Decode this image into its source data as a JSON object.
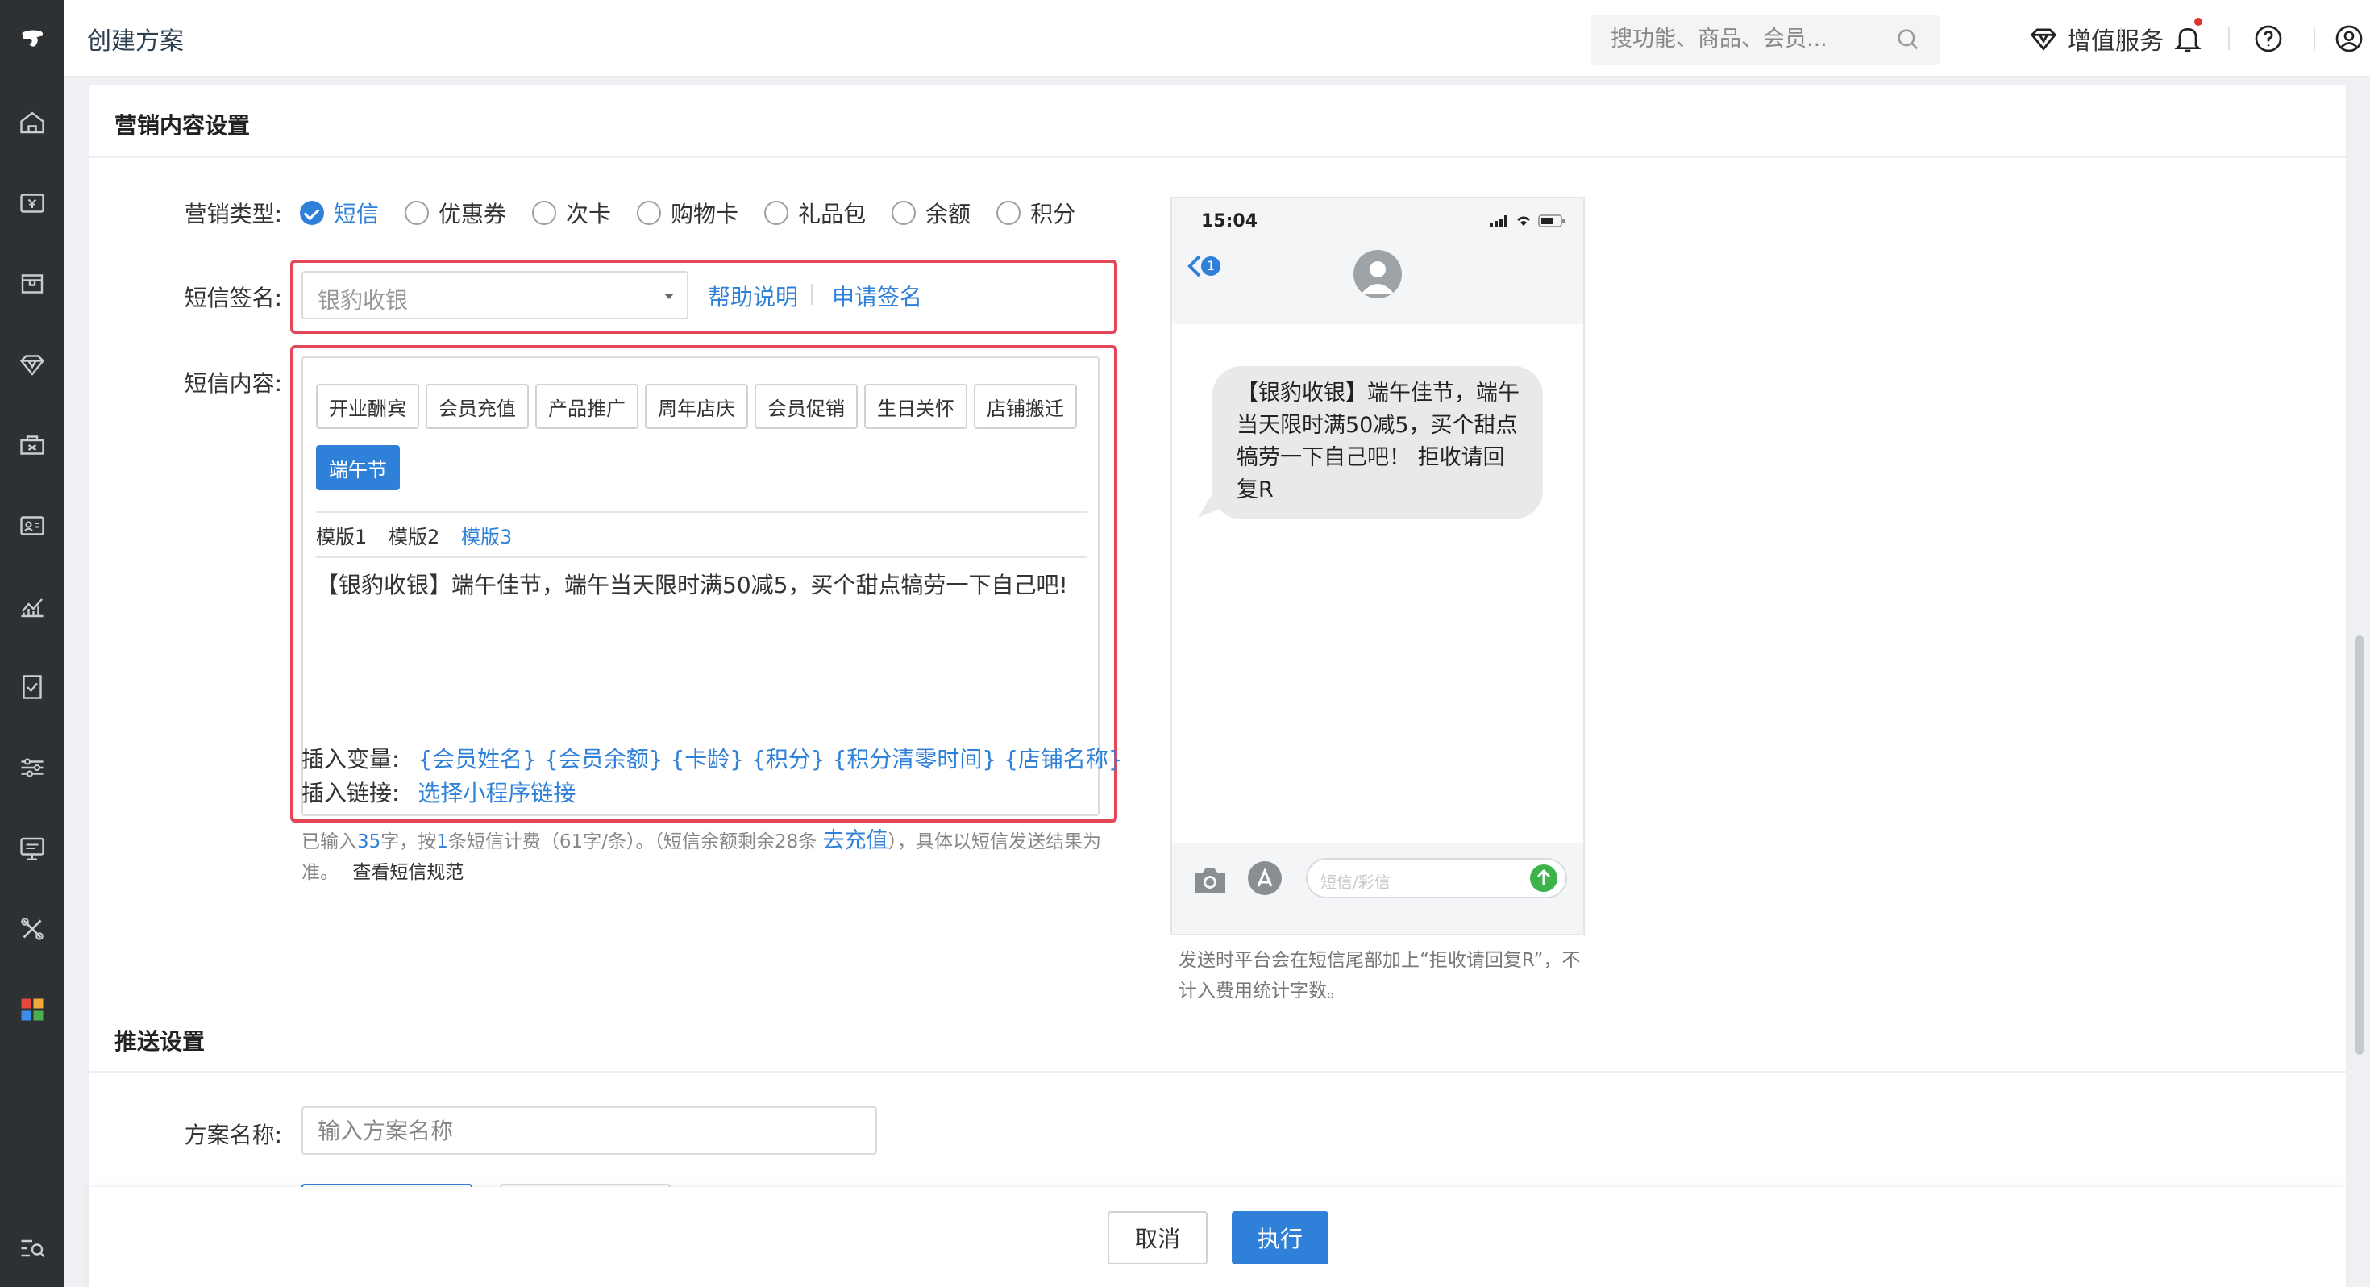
{
  "header": {
    "title": "创建方案",
    "search_placeholder": "搜功能、商品、会员...",
    "value_added_service": "增值服务"
  },
  "sidebar": {
    "items": [
      "home-icon",
      "cashier-icon",
      "product-icon",
      "member-icon",
      "marketing-icon",
      "customer-card-icon",
      "report-icon",
      "finance-icon",
      "settings-icon",
      "device-icon",
      "tools-icon",
      "apps-icon",
      "help-search-icon"
    ]
  },
  "marketing_content": {
    "section_title": "营销内容设置",
    "type_label": "营销类型:",
    "types": [
      "短信",
      "优惠券",
      "次卡",
      "购物卡",
      "礼品包",
      "余额",
      "积分"
    ],
    "selected_type": "短信",
    "signature_label": "短信签名:",
    "signature_value": "银豹收银",
    "help_link": "帮助说明",
    "apply_link": "申请签名",
    "content_label": "短信内容:",
    "template_tags": [
      "开业酬宾",
      "会员充值",
      "产品推广",
      "周年店庆",
      "会员促销",
      "生日关怀",
      "店铺搬迁",
      "端午节"
    ],
    "active_tag": "端午节",
    "template_tabs": [
      "模版1",
      "模版2",
      "模版3"
    ],
    "active_template_tab": "模版3",
    "sms_text": "【银豹收银】端午佳节，端午当天限时满50减5，买个甜点犒劳一下自己吧!",
    "insert_var_label": "插入变量:",
    "variables": [
      "{会员姓名}",
      "{会员余额}",
      "{卡龄}",
      "{积分}",
      "{积分清零时间}",
      "{店铺名称}"
    ],
    "insert_link_label": "插入链接:",
    "mini_program_link": "选择小程序链接",
    "note": {
      "p1": "已输入",
      "chars": "35",
      "p2": "字，按",
      "count": "1",
      "p3": "条短信计费（61字/条）。（短信余额剩余28条",
      "recharge": "去充值",
      "p4": "），具体以短信发送结果为准。",
      "spec_link": "查看短信规范"
    }
  },
  "phone_preview": {
    "time": "15:04",
    "back_badge": "1",
    "message": "【银豹收银】端午佳节，端午当天限时满50减5，买个甜点犒劳一下自己吧！ 拒收请回复R",
    "input_placeholder": "短信/彩信",
    "note": "发送时平台会在短信尾部加上“拒收请回复R”，不计入费用统计字数。"
  },
  "push_settings": {
    "section_title": "推送设置",
    "plan_name_label": "方案名称:",
    "plan_name_placeholder": "输入方案名称"
  },
  "footer": {
    "cancel": "取消",
    "execute": "执行"
  },
  "colors": {
    "accent": "#2f80d8",
    "highlight_border": "#e44657",
    "sidebar_bg": "#2e3134",
    "send_button": "#3cb44b"
  }
}
